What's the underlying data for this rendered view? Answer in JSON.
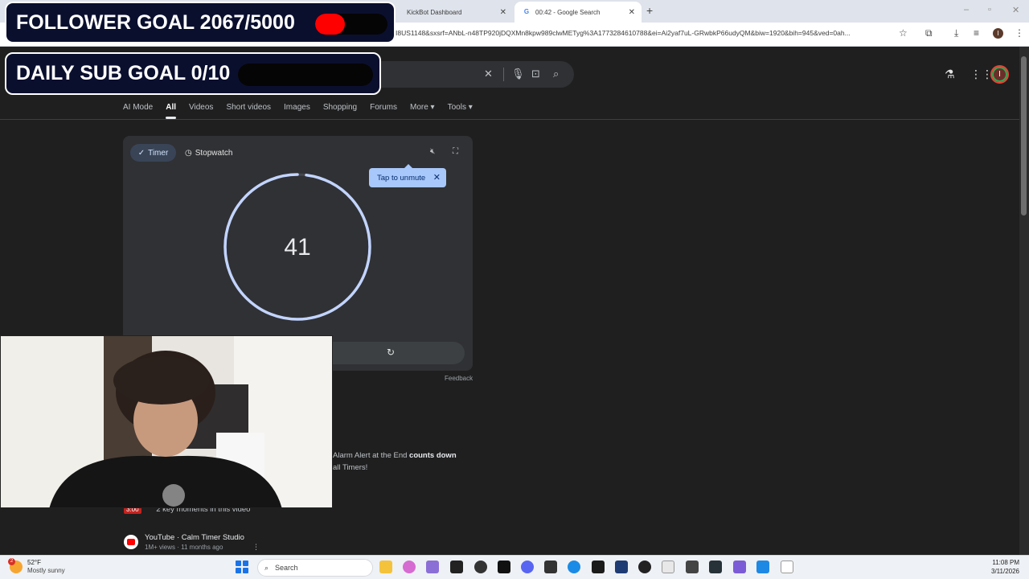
{
  "browser": {
    "tabs": [
      {
        "title": "KickBot Dashboard",
        "active": false
      },
      {
        "title": "00:42 - Google Search",
        "active": true
      }
    ],
    "url": "I8US1148&sxsrf=ANbL-n48TP920jDQXMn8kpw989clwMETyg%3A1773284610788&ei=Ai2yaf7uL-GRwbkP66udyQM&biw=1920&bih=945&ved=0ah...",
    "profile_initial": "I"
  },
  "overlays": {
    "follower_goal": "FOLLOWER GOAL 2067/5000",
    "follower_progress": 0.41,
    "sub_goal": "DAILY SUB GOAL 0/10",
    "sub_progress": 0
  },
  "google": {
    "nav_tabs": [
      "AI Mode",
      "All",
      "Videos",
      "Short videos",
      "Images",
      "Shopping",
      "Forums",
      "More ▾",
      "Tools ▾"
    ],
    "active_tab": "All",
    "avatar_initial": "I"
  },
  "timer": {
    "tab_timer": "Timer",
    "tab_stopwatch": "Stopwatch",
    "tooltip": "Tap to unmute",
    "display": "41",
    "progress_remaining": 0.98,
    "feedback": "Feedback"
  },
  "results": {
    "snippet_line1": "Alarm Alert at the End ",
    "snippet_bold": "counts down",
    "snippet_line2": "all Timers!",
    "key_moments_badge": "3:00",
    "key_moments": "2 key moments in this video",
    "source": "YouTube · Calm Timer Studio",
    "meta": "1M+ views · 11 months ago"
  },
  "taskbar": {
    "temp": "52°F",
    "weather": "Mostly sunny",
    "weather_badge": "2",
    "search_placeholder": "Search",
    "time": "11:08 PM",
    "date": "3/11/2026"
  }
}
